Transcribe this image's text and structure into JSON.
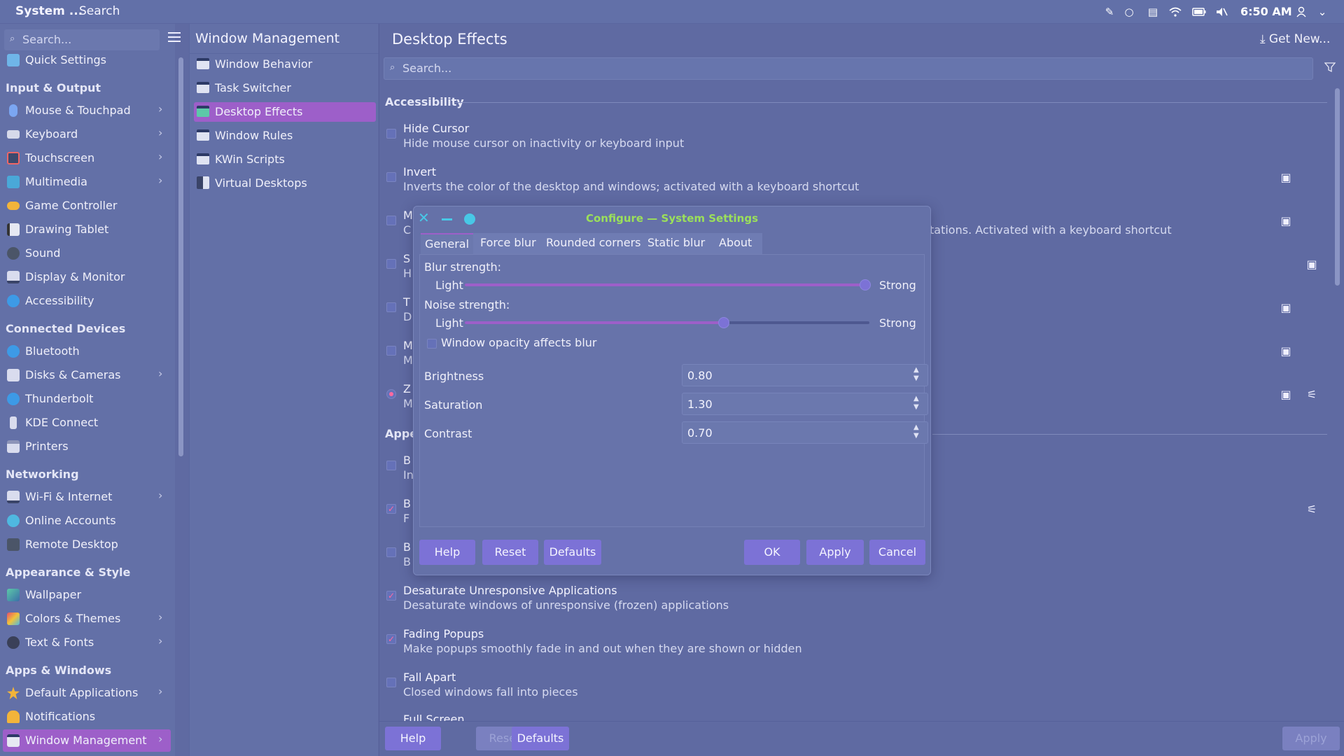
{
  "topbar": {
    "app_title": "System ...",
    "search_label": "Search",
    "clock": "6:50 AM"
  },
  "sidebar": {
    "search_placeholder": "Search...",
    "quick_settings": "Quick Settings",
    "sections": {
      "input_output": "Input & Output",
      "connected_devices": "Connected Devices",
      "networking": "Networking",
      "appearance_style": "Appearance & Style",
      "apps_windows": "Apps & Windows"
    },
    "items": {
      "mouse_touchpad": "Mouse & Touchpad",
      "keyboard": "Keyboard",
      "touchscreen": "Touchscreen",
      "multimedia": "Multimedia",
      "game_controller": "Game Controller",
      "drawing_tablet": "Drawing Tablet",
      "sound": "Sound",
      "display_monitor": "Display & Monitor",
      "accessibility": "Accessibility",
      "bluetooth": "Bluetooth",
      "disks_cameras": "Disks & Cameras",
      "thunderbolt": "Thunderbolt",
      "kde_connect": "KDE Connect",
      "printers": "Printers",
      "wifi_internet": "Wi-Fi & Internet",
      "online_accounts": "Online Accounts",
      "remote_desktop": "Remote Desktop",
      "wallpaper": "Wallpaper",
      "colors_themes": "Colors & Themes",
      "text_fonts": "Text & Fonts",
      "default_applications": "Default Applications",
      "notifications": "Notifications",
      "window_management": "Window Management"
    }
  },
  "midcol": {
    "header": "Window Management",
    "items": {
      "window_behavior": "Window Behavior",
      "task_switcher": "Task Switcher",
      "desktop_effects": "Desktop Effects",
      "window_rules": "Window Rules",
      "kwin_scripts": "KWin Scripts",
      "virtual_desktops": "Virtual Desktops"
    }
  },
  "main": {
    "header": "Desktop Effects",
    "get_new": "Get New...",
    "search_placeholder": "Search...",
    "groups": {
      "accessibility": "Accessibility",
      "appearance_partial": "Appe"
    },
    "effects": {
      "hide_cursor": {
        "name": "Hide Cursor",
        "desc": "Hide mouse cursor on inactivity or keyboard input"
      },
      "invert": {
        "name": "Invert",
        "desc": "Inverts the color of the desktop and windows; activated with a keyboard shortcut"
      },
      "magnifier_partial": {
        "name": "M",
        "desc": "C",
        "desc_tail": "tations. Activated with a keyboard shortcut"
      },
      "row4_partial": {
        "name": "S",
        "desc": "H"
      },
      "row5_partial": {
        "name": "T",
        "desc": "D"
      },
      "row6_partial": {
        "name": "M",
        "desc": "M"
      },
      "row7_partial": {
        "name": "Z",
        "desc": "M"
      },
      "row8_partial": {
        "name": "B",
        "desc": "In"
      },
      "row9_partial": {
        "name": "B",
        "desc": "F"
      },
      "row10_partial": {
        "name": "B",
        "desc": "B"
      },
      "desaturate": {
        "name": "Desaturate Unresponsive Applications",
        "desc": "Desaturate windows of unresponsive (frozen) applications"
      },
      "fading_popups": {
        "name": "Fading Popups",
        "desc": "Make popups smoothly fade in and out when they are shown or hidden"
      },
      "fall_apart": {
        "name": "Fall Apart",
        "desc": "Closed windows fall into pieces"
      },
      "full_screen_partial": {
        "name": "Full Screen"
      }
    },
    "bottom": {
      "help": "Help",
      "reset": "Reset",
      "defaults": "Defaults",
      "apply": "Apply"
    }
  },
  "dialog": {
    "title": "Configure — System Settings",
    "tabs": {
      "general": "General",
      "force_blur": "Force blur",
      "rounded_corners": "Rounded corners",
      "static_blur": "Static blur",
      "about": "About"
    },
    "blur_strength_label": "Blur strength:",
    "noise_strength_label": "Noise strength:",
    "light": "Light",
    "strong": "Strong",
    "blur_strength_value": 0.99,
    "noise_strength_value": 0.64,
    "window_opacity_label": "Window opacity affects blur",
    "brightness_label": "Brightness",
    "brightness_value": "0.80",
    "saturation_label": "Saturation",
    "saturation_value": "1.30",
    "contrast_label": "Contrast",
    "contrast_value": "0.70",
    "buttons": {
      "help": "Help",
      "reset": "Reset",
      "defaults": "Defaults",
      "ok": "OK",
      "apply": "Apply",
      "cancel": "Cancel"
    }
  },
  "colors": {
    "accent": "#9d5fc9",
    "button": "#7c72d6",
    "title_green": "#9be05a",
    "window_controls": "#48c8e6"
  }
}
